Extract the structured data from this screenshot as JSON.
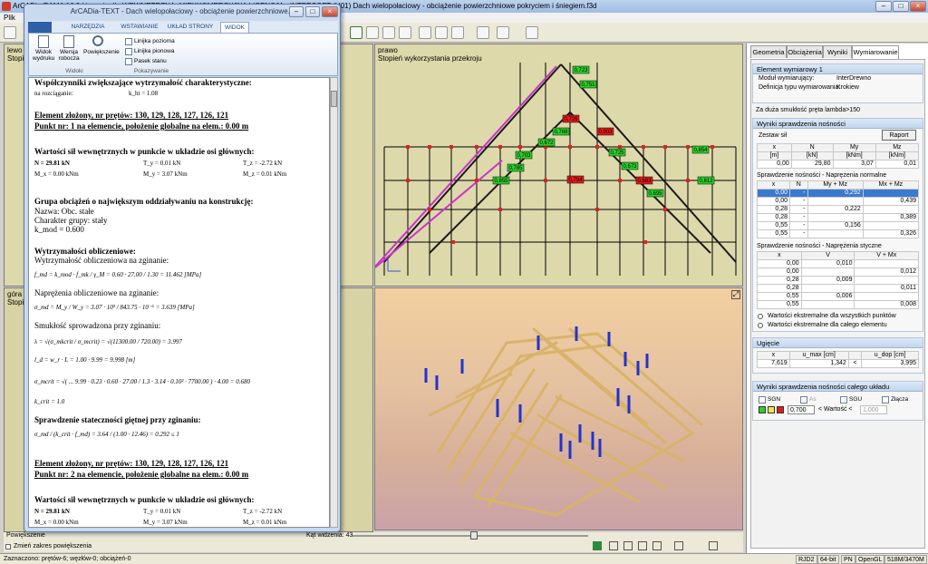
{
  "main": {
    "title": "ArCADia-RAMA 16.0 Licencja dla WEWNĘTRZNA, MIĘKKOMERCYJNA LICENCJA - INTERSOFT (U01) Dach wielopołaciowy - obciążenie powierzchniowe pokryciem i śniegiem.f3d",
    "menu_file": "Plik"
  },
  "viewports": {
    "left_top_label": "lewo",
    "left_top_sub": "Stopień",
    "left_bottom_label": "góra",
    "left_bottom_sub": "Stopi",
    "right_top_label": "prawo",
    "right_top_sub": "Stopień wykorzystania przekroju",
    "angle_label": "Kąt widzenia: 43",
    "scale_label": "Powiększenie",
    "zoom_toggle": "Zmień zakres powiększenia",
    "ratio_labels": [
      "0,723",
      "0,751",
      "0,726",
      "0,768",
      "0,672",
      "0,703",
      "0,785",
      "0,855",
      "0,794",
      "0,903",
      "0,854",
      "0,812",
      "0,725",
      "0,673",
      "0,683",
      "0,695"
    ]
  },
  "text_window": {
    "title": "ArCADia-TEXT - Dach wielopołaciowy - obciążenie powierzchniowe...",
    "tabs": [
      "NARZĘDZIA GŁÓWNE",
      "WSTAWIANIE",
      "UKŁAD STRONY",
      "WIDOK"
    ],
    "ribbon": {
      "btn_widok": "Widok wydruku",
      "btn_wersja": "Wersja robocza",
      "btn_powiekszenie": "Powiększenie",
      "group_widoki": "Widoki",
      "chk_linijka_pozioma": "Linijka pozioma",
      "chk_linijka_pionowa": "Linijka pionowa",
      "chk_pasek_stanu": "Pasek stanu",
      "group_pokazywanie": "Pokazywanie"
    },
    "doc": {
      "l1": "Współczynniki zwiększające wytrzymałość charakterystyczne:",
      "l2": "na rozciąganie:",
      "l2v": "k_ht = 1.08",
      "l3": "Element złożony, nr prętów: 130, 129, 128, 127, 126, 121",
      "l4": "Punkt nr: 1 na elemencie, położenie globalne na elem.: 0.00 m",
      "l5": "Wartości sił wewnętrznych w punkcie w układzie osi głównych:",
      "f1a": "N = 29.81 kN",
      "f1b": "T_y = 0.01 kN",
      "f1c": "T_z = -2.72 kN",
      "f2a": "M_x = 0.00 kNm",
      "f2b": "M_y = 3.07 kNm",
      "f2c": "M_z = 0.01 kNm",
      "l6": "Grupa obciążeń o największym oddziaływaniu na konstrukcję:",
      "l7": "Nazwa: Obc. stałe",
      "l8": "Charakter grupy: stały",
      "l9": "k_mod = 0.600",
      "l10": "Wytrzymałości obliczeniowe:",
      "l11": "Wytrzymałość obliczeniowa na zginanie:",
      "e1": "f_md = k_mod · f_mk / γ_M = 0.60 · 27.00 / 1.30 = 11.462 [MPa]",
      "l12": "Naprężenia obliczeniowe na zginanie:",
      "e2": "σ_md = M_y / W_y = 3.07 · 10³ / 843.75 · 10⁻⁶ = 3.639 [MPa]",
      "l13": "Smukłość sprowadzona przy zginaniu:",
      "e3": "λ = √(σ_mkcrit / σ_mcrit) = √(11300.00 / 720.00) = 3.997",
      "e4": "l_d = w_r · L = 1.00 · 9.99 = 9.998 [m]",
      "e5": "σ_mcrit = √( ... 9.99 · 0.23 · 0.60 · 27.00 / 1.3 · 3.14 · 0.10² · 7700.00 ) · 4.00 = 0.680",
      "e6": "k_crit = 1.0",
      "l14": "Sprawdzenie stateczności giętnej przy zginaniu:",
      "e7": "σ_md / (k_crit · f_md) = 3.64 / (1.00 · 12.46) = 0.292 ≤ 1",
      "l15": "Element złożony, nr prętów: 130, 129, 128, 127, 126, 121",
      "l16": "Punkt nr: 2 na elemencie, położenie globalne na elem.: 0.00 m",
      "l17": "Wartości sił wewnętrznych w punkcie w układzie osi głównych:",
      "f3a": "N = 29.81 kN",
      "f3b": "T_y = 0.01 kN",
      "f3c": "T_z = -2.72 kN",
      "f4a": "M_x = 0.00 kNm",
      "f4b": "M_y = 3.07 kNm",
      "f4c": "M_z = 0.01 kNm"
    }
  },
  "panel": {
    "tabs": [
      "Geometria",
      "Obciążenia",
      "Wyniki",
      "Wymiarowanie"
    ],
    "element_title": "Element wymiarowy 1",
    "modul_label": "Moduł wymiarujący:",
    "modul_value": "InterDrewno",
    "def_label": "Definicja typu wymiarowania:",
    "def_value": "Krokiew",
    "warning": "Za duża smukłość pręta lambda>150",
    "wyniki_title": "Wyniki sprawdzenia nośności",
    "zestaw_label": "Zestaw sił",
    "raport_btn": "Raport",
    "forces": {
      "head": [
        "x",
        "N",
        "My",
        "Mz"
      ],
      "units": [
        "[m]",
        "[kN]",
        "[kNm]",
        "[kNm]"
      ],
      "row": [
        "0,00",
        "29,80",
        "3,07",
        "0,01"
      ]
    },
    "normal_title": "Sprawdzenie nośności - Naprężenia normalne",
    "normal": {
      "head": [
        "x",
        "N",
        "My + Mz",
        "Mx + Mz"
      ],
      "rows": [
        [
          "0,00",
          "-",
          "0,292",
          ""
        ],
        [
          "0,00",
          "-",
          "",
          "0,439"
        ],
        [
          "0,28",
          "-",
          "0,222",
          ""
        ],
        [
          "0,28",
          "-",
          "",
          "0,389"
        ],
        [
          "0,55",
          "-",
          "0,156",
          ""
        ],
        [
          "0,55",
          "-",
          "",
          "0,326"
        ]
      ]
    },
    "shear_title": "Sprawdzenie nośności - Naprężenia styczne",
    "shear": {
      "head": [
        "x",
        "V",
        "V + Mx"
      ],
      "rows": [
        [
          "0,00",
          "0,010",
          ""
        ],
        [
          "0,00",
          "",
          "0,012"
        ],
        [
          "0,28",
          "0,009",
          ""
        ],
        [
          "0,28",
          "",
          "0,011"
        ],
        [
          "0,55",
          "0,006",
          ""
        ],
        [
          "0,55",
          "",
          "0,008"
        ]
      ]
    },
    "radio1": "Wartości ekstremalne dla wszystkich punktów",
    "radio2": "Wartości ekstremalne dla całego elementu",
    "ugiecie_title": "Ugięcie",
    "ugiecie": {
      "head": [
        "x",
        "u_max [cm]",
        "u_dop [cm]"
      ],
      "row": [
        "7,619",
        "1,342",
        "3,995"
      ],
      "sign": "<"
    },
    "wyniki_calego_title": "Wyniki sprawdzenia nośności całego układu",
    "sgn": "SGN",
    "as": "As",
    "sgu": "SGU",
    "zlacza": "Złącza",
    "val1": "0,700",
    "wartosc": "< Wartość <",
    "val2": "1,000"
  },
  "status": {
    "left": "Zaznaczono: prętów-6; węzłów-0; obciążeń-0",
    "r1": "RJD2",
    "r2": "64-bit",
    "r3": "PN",
    "r4": "OpenGL",
    "mem": "518M/3470M"
  },
  "colors": {
    "accent": "#3a79d0",
    "green_label": "#2bd12b",
    "red_label": "#e51b1b",
    "timber": "#d9b36a"
  }
}
